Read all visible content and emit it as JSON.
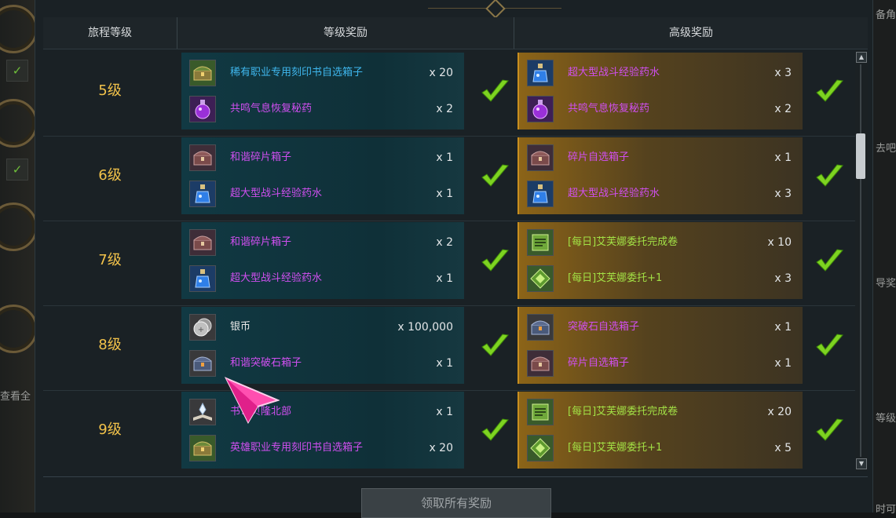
{
  "background": {
    "left_label": "查看全",
    "right_fragments": [
      "备角",
      "去吧",
      "导奖",
      "等级",
      "时可"
    ]
  },
  "header": {
    "col_level": "旅程等级",
    "col_normal": "等级奖励",
    "col_advanced": "高级奖励"
  },
  "rows": [
    {
      "level": "5级",
      "normal": [
        {
          "name": "稀有职业专用刻印书自选箱子",
          "qty": "x 20",
          "quality": "rare",
          "icon": "chest-green-icon"
        },
        {
          "name": "共鸣气息恢复秘药",
          "qty": "x 2",
          "quality": "epic",
          "icon": "potion-purple-icon"
        }
      ],
      "advanced": [
        {
          "name": "超大型战斗经验药水",
          "qty": "x 3",
          "quality": "epic",
          "icon": "potion-blue-icon"
        },
        {
          "name": "共鸣气息恢复秘药",
          "qty": "x 2",
          "quality": "epic",
          "icon": "potion-purple-icon"
        }
      ]
    },
    {
      "level": "6级",
      "normal": [
        {
          "name": "和谐碎片箱子",
          "qty": "x 1",
          "quality": "epic",
          "icon": "chest-red-icon"
        },
        {
          "name": "超大型战斗经验药水",
          "qty": "x 1",
          "quality": "epic",
          "icon": "potion-blue-icon"
        }
      ],
      "advanced": [
        {
          "name": "碎片自选箱子",
          "qty": "x 1",
          "quality": "epic",
          "icon": "chest-red-icon"
        },
        {
          "name": "超大型战斗经验药水",
          "qty": "x 3",
          "quality": "epic",
          "icon": "potion-blue-icon"
        }
      ]
    },
    {
      "level": "7级",
      "normal": [
        {
          "name": "和谐碎片箱子",
          "qty": "x 2",
          "quality": "epic",
          "icon": "chest-red-icon"
        },
        {
          "name": "超大型战斗经验药水",
          "qty": "x 1",
          "quality": "epic",
          "icon": "potion-blue-icon"
        }
      ],
      "advanced": [
        {
          "name": "[每日]艾芙娜委托完成卷",
          "qty": "x 10",
          "quality": "green",
          "icon": "scroll-green-icon"
        },
        {
          "name": "[每日]艾芙娜委托+1",
          "qty": "x 3",
          "quality": "green",
          "icon": "emblem-green-icon"
        }
      ]
    },
    {
      "level": "8级",
      "normal": [
        {
          "name": "银币",
          "qty": "x 100,000",
          "quality": "white",
          "icon": "silver-coin-icon"
        },
        {
          "name": "和谐突破石箱子",
          "qty": "x 1",
          "quality": "epic",
          "icon": "chest-blue-icon"
        }
      ],
      "advanced": [
        {
          "name": "突破石自选箱子",
          "qty": "x 1",
          "quality": "epic",
          "icon": "chest-blue-icon"
        },
        {
          "name": "碎片自选箱子",
          "qty": "x 1",
          "quality": "epic",
          "icon": "chest-red-icon"
        }
      ]
    },
    {
      "level": "9级",
      "normal": [
        {
          "name": "书：贝隆北部",
          "qty": "x 1",
          "quality": "epic",
          "icon": "book-icon"
        },
        {
          "name": "英雄职业专用刻印书自选箱子",
          "qty": "x 20",
          "quality": "epic",
          "icon": "chest-green-icon"
        }
      ],
      "advanced": [
        {
          "name": "[每日]艾芙娜委托完成卷",
          "qty": "x 20",
          "quality": "green",
          "icon": "scroll-green-icon"
        },
        {
          "name": "[每日]艾芙娜委托+1",
          "qty": "x 5",
          "quality": "green",
          "icon": "emblem-green-icon"
        }
      ]
    }
  ],
  "footer": {
    "claim_all_label": "领取所有奖励"
  },
  "colors": {
    "level_text": "#f2c24a",
    "rare": "#3fb7ee",
    "epic": "#d04ff0",
    "green": "#a2e045",
    "check": "#7ed321"
  }
}
